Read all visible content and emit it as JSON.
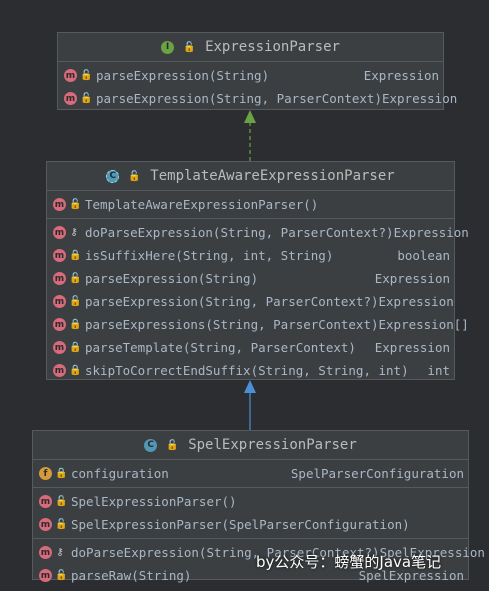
{
  "colors": {
    "background": "#2b2d30",
    "box": "#3c3f41",
    "implements_arrow": "#6ba344",
    "extends_arrow": "#4d8fd6"
  },
  "expression_parser": {
    "badge": "I",
    "name": "ExpressionParser",
    "methods": [
      {
        "sig": "parseExpression(String)",
        "type": "Expression"
      },
      {
        "sig": "parseExpression(String, ParserContext)",
        "type": "Expression"
      }
    ]
  },
  "template_parser": {
    "badge": "C",
    "name": "TemplateAwareExpressionParser",
    "constructors": [
      {
        "sig": "TemplateAwareExpressionParser()",
        "type": ""
      }
    ],
    "methods": [
      {
        "sig": "doParseExpression(String, ParserContext?)",
        "type": "Expression",
        "vis": "protected"
      },
      {
        "sig": "isSuffixHere(String, int, String)",
        "type": "boolean",
        "vis": "private"
      },
      {
        "sig": "parseExpression(String)",
        "type": "Expression",
        "vis": "public"
      },
      {
        "sig": "parseExpression(String, ParserContext?)",
        "type": "Expression",
        "vis": "public"
      },
      {
        "sig": "parseExpressions(String, ParserContext)",
        "type": "Expression[]",
        "vis": "private"
      },
      {
        "sig": "parseTemplate(String, ParserContext)",
        "type": "Expression",
        "vis": "private"
      },
      {
        "sig": "skipToCorrectEndSuffix(String, String, int)",
        "type": "int",
        "vis": "private"
      }
    ]
  },
  "spel_parser": {
    "badge": "C",
    "name": "SpelExpressionParser",
    "fields": [
      {
        "sig": "configuration",
        "type": "SpelParserConfiguration"
      }
    ],
    "constructors": [
      {
        "sig": "SpelExpressionParser()",
        "type": ""
      },
      {
        "sig": "SpelExpressionParser(SpelParserConfiguration)",
        "type": ""
      }
    ],
    "methods": [
      {
        "sig": "doParseExpression(String, ParserContext?)",
        "type": "SpelExpression",
        "vis": "protected"
      },
      {
        "sig": "parseRaw(String)",
        "type": "SpelExpression",
        "vis": "public"
      }
    ]
  },
  "watermark": "by公众号：螃蟹的Java笔记"
}
